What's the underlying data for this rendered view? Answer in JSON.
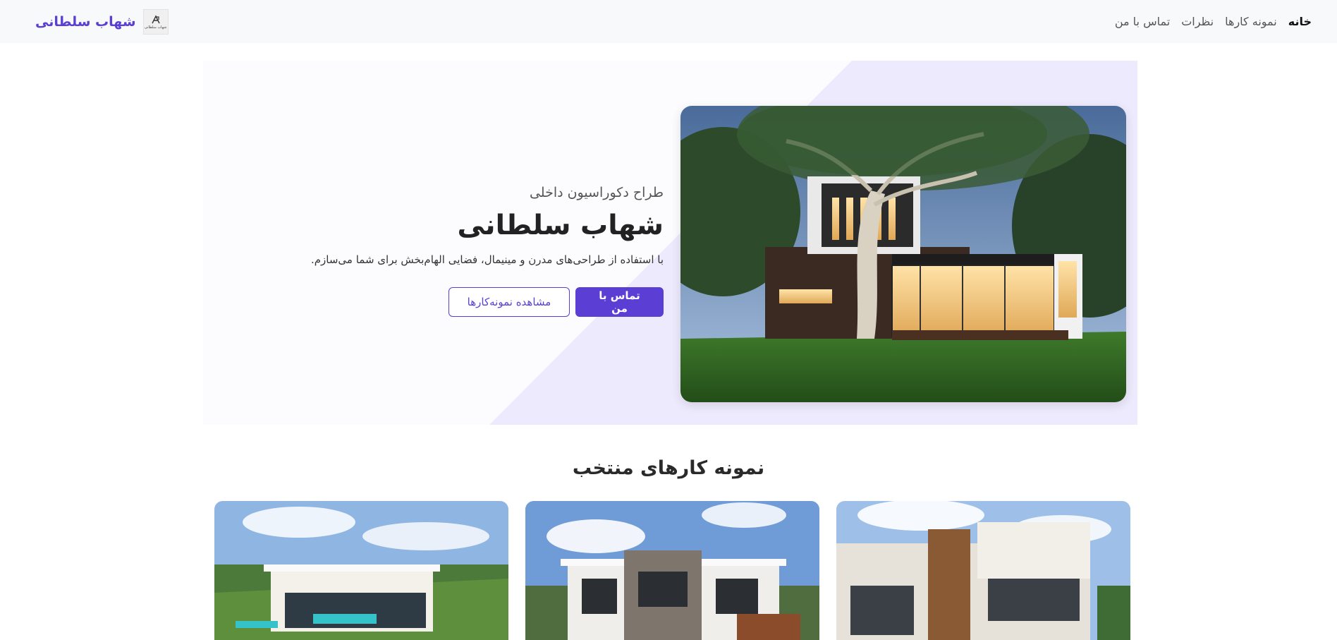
{
  "navbar": {
    "brand_name": "شهاب سلطانی",
    "logo_caption": "شهاب سلطانی",
    "links": [
      {
        "label": "خانه",
        "active": true
      },
      {
        "label": "نمونه کارها",
        "active": false
      },
      {
        "label": "نظرات",
        "active": false
      },
      {
        "label": "تماس با من",
        "active": false
      }
    ]
  },
  "hero": {
    "subtitle": "طراح دکوراسیون داخلی",
    "title": "شهاب سلطانی",
    "description": "با استفاده از طراحی‌های مدرن و مینیمال، فضایی الهام‌بخش برای شما می‌سازم.",
    "primary_button": "تماس با من",
    "secondary_button": "مشاهده نمونه‌کارها"
  },
  "portfolio": {
    "title": "نمونه کارهای منتخب"
  },
  "colors": {
    "accent": "#5b3fd4",
    "hero_triangle": "#eeeafd",
    "navbar_bg": "#f8f9fa"
  }
}
